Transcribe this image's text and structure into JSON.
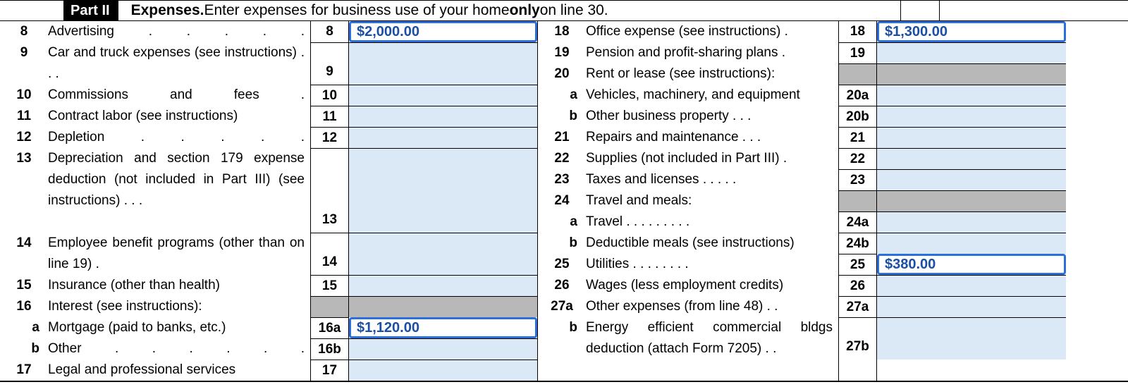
{
  "header": {
    "part_label": "Part II",
    "title_bold1": "Expenses.",
    "title_plain": " Enter expenses for business use of your home ",
    "title_bold2": "only",
    "title_plain2": " on line 30."
  },
  "left": [
    {
      "num": "8",
      "label": "Advertising .    .    .    .    .",
      "box": "8",
      "value": "$2,000.00",
      "filled": true
    },
    {
      "num": "9",
      "label": "Car and truck expenses (see instructions)   .    .    .",
      "multi": true,
      "box": "9",
      "value": "",
      "boxrows": 2
    },
    {
      "num": "10",
      "label": "Commissions and fees    .",
      "box": "10",
      "value": ""
    },
    {
      "num": "11",
      "label": "Contract labor (see instructions)",
      "box": "11",
      "value": ""
    },
    {
      "num": "12",
      "label": "Depletion    .    .    .    .    .",
      "box": "12",
      "value": ""
    },
    {
      "num": "13",
      "label": "Depreciation and section 179 expense deduction (not included in Part III) (see instructions)     .    .    .",
      "multi": true,
      "box": "13",
      "value": "",
      "boxrows": 4
    },
    {
      "num": "14",
      "label": "Employee benefit programs (other than on line 19)    .",
      "multi": true,
      "box": "14",
      "value": "",
      "boxrows": 2
    },
    {
      "num": "15",
      "label": "Insurance (other than health)",
      "box": "15",
      "value": ""
    },
    {
      "num": "16",
      "label": "Interest (see instructions):",
      "nolead": true
    },
    {
      "sub": "a",
      "label": "Mortgage (paid to banks, etc.)",
      "box": "16a",
      "value": "$1,120.00",
      "filled": true
    },
    {
      "sub": "b",
      "label": "Other    .    .    .    .    .    .",
      "box": "16b",
      "value": ""
    },
    {
      "num": "17",
      "label": "Legal and professional services",
      "box": "17",
      "value": ""
    }
  ],
  "right": [
    {
      "num": "18",
      "label": "Office expense (see instructions)  .",
      "box": "18",
      "value": "$1,300.00",
      "filled": true
    },
    {
      "num": "19",
      "label": "Pension and profit-sharing plans  .",
      "box": "19",
      "value": ""
    },
    {
      "num": "20",
      "label": "Rent or lease (see instructions):",
      "nolead": true
    },
    {
      "sub": "a",
      "label": "Vehicles, machinery, and equipment",
      "box": "20a",
      "value": ""
    },
    {
      "sub": "b",
      "label": "Other business property    .    .    .",
      "box": "20b",
      "value": ""
    },
    {
      "num": "21",
      "label": "Repairs and maintenance  .    .    .",
      "box": "21",
      "value": ""
    },
    {
      "num": "22",
      "label": "Supplies (not included in Part III)   .",
      "box": "22",
      "value": ""
    },
    {
      "num": "23",
      "label": "Taxes and licenses .    .    .    .    .",
      "box": "23",
      "value": ""
    },
    {
      "num": "24",
      "label": "Travel and meals:",
      "nolead": true
    },
    {
      "sub": "a",
      "label": "Travel .    .    .    .    .    .    .    .    .",
      "box": "24a",
      "value": ""
    },
    {
      "sub": "b",
      "label": "Deductible meals (see instructions)",
      "box": "24b",
      "value": ""
    },
    {
      "num": "25",
      "label": "Utilities    .    .    .    .    .    .    .    .",
      "box": "25",
      "value": "$380.00",
      "filled": true
    },
    {
      "num": "26",
      "label": "Wages (less employment credits)",
      "box": "26",
      "value": ""
    },
    {
      "num": "27a",
      "label": "Other expenses (from line 48)  .    .",
      "box": "27a",
      "value": ""
    },
    {
      "sub": "b",
      "label": "Energy efficient commercial bldgs deduction (attach Form 7205)  .    .",
      "multi": true,
      "box": "27b",
      "value": "",
      "boxrows": 2
    }
  ]
}
